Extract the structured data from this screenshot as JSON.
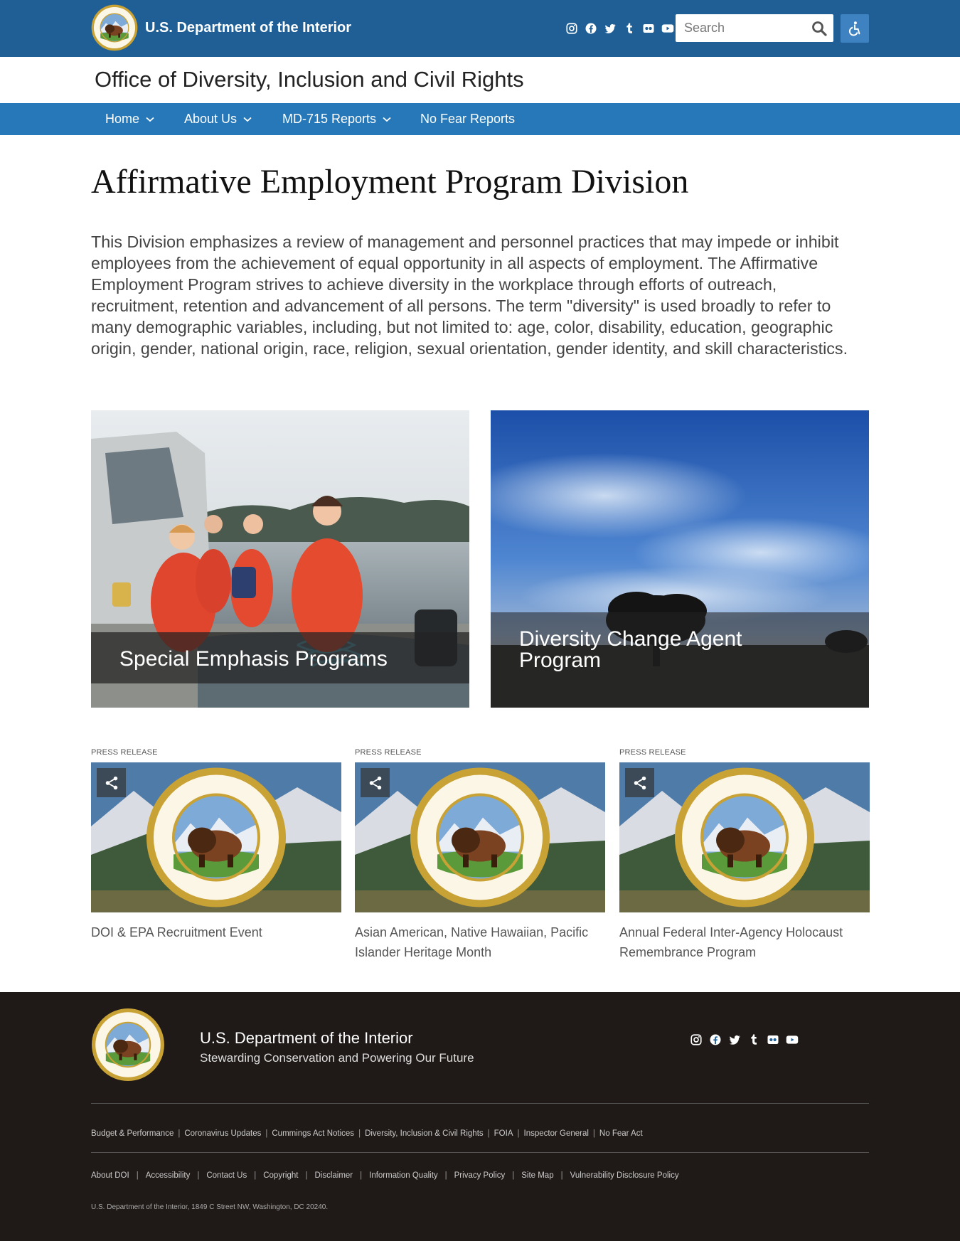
{
  "header": {
    "brand_name": "U.S. Department of the Interior",
    "search_placeholder": "Search",
    "office_title": "Office of Diversity, Inclusion and Civil Rights",
    "social_icons": [
      "instagram-icon",
      "facebook-icon",
      "twitter-icon",
      "tumblr-icon",
      "flickr-icon",
      "youtube-icon"
    ]
  },
  "nav": {
    "items": [
      {
        "label": "Home",
        "has_dropdown": true
      },
      {
        "label": "About Us",
        "has_dropdown": true
      },
      {
        "label": "MD-715 Reports",
        "has_dropdown": true
      },
      {
        "label": "No Fear Reports",
        "has_dropdown": false
      }
    ]
  },
  "main": {
    "title": "Affirmative Employment Program Division",
    "intro": "This Division emphasizes a review of management and personnel practices that may impede or inhibit employees from the achievement of equal opportunity in all aspects of employment. The Affirmative Employment Program strives to achieve diversity in the workplace through efforts of outreach, recruitment, retention and advancement of all persons. The term \"diversity\" is used broadly to refer to many demographic variables, including, but not limited to: age, color, disability, education, geographic origin, gender, national origin, race, religion, sexual orientation, gender identity, and skill characteristics.",
    "features": [
      {
        "title": "Special Emphasis Programs"
      },
      {
        "title": "Diversity Change Agent Program"
      }
    ],
    "cards": [
      {
        "kicker": "PRESS RELEASE",
        "title": "DOI & EPA Recruitment Event"
      },
      {
        "kicker": "PRESS RELEASE",
        "title": "Asian American, Native Hawaiian, Pacific Islander Heritage Month"
      },
      {
        "kicker": "PRESS RELEASE",
        "title": "Annual Federal Inter-Agency Holocaust Remembrance Program"
      }
    ]
  },
  "footer": {
    "name": "U.S. Department of the Interior",
    "tagline": "Stewarding Conservation and Powering Our Future",
    "links_primary": [
      "Budget & Performance",
      "Coronavirus Updates",
      "Cummings Act Notices",
      "Diversity, Inclusion & Civil Rights",
      "FOIA",
      "Inspector General",
      "No Fear Act"
    ],
    "links_secondary": [
      "About DOI",
      "Accessibility",
      "Contact Us",
      "Copyright",
      "Disclaimer",
      "Information Quality",
      "Privacy Policy",
      "Site Map",
      "Vulnerability Disclosure Policy"
    ],
    "address": "U.S. Department of the Interior, 1849 C Street NW, Washington, DC 20240."
  },
  "colors": {
    "header_blue": "#1f5f95",
    "nav_blue": "#2778b9",
    "footer_dark": "#1f1a17"
  }
}
